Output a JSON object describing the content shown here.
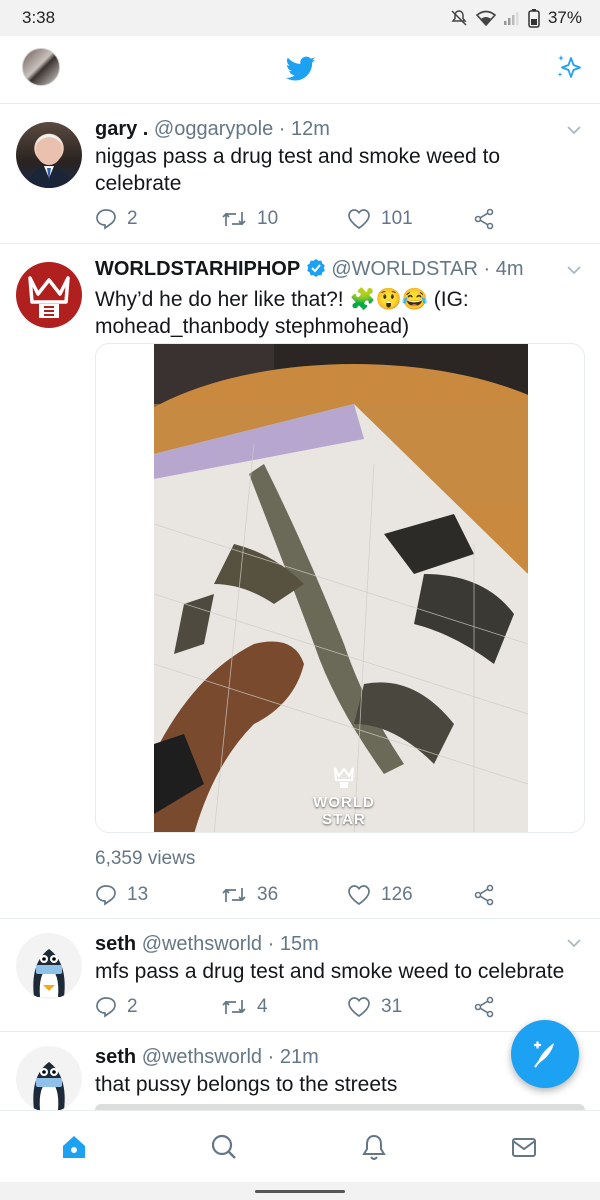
{
  "status_bar": {
    "time": "3:38",
    "battery": "37%"
  },
  "header": {
    "logo_icon": "twitter-bird-icon",
    "sparkle_icon": "sparkle-icon",
    "accent": "#1da1f2"
  },
  "tweets": [
    {
      "name": "gary .",
      "handle": "@oggarypole",
      "time": "12m",
      "text": "niggas pass a drug test and smoke weed to celebrate",
      "replies": "2",
      "retweets": "10",
      "likes": "101"
    },
    {
      "name": "WORLDSTARHIPHOP",
      "handle": "@WORLDSTAR",
      "time": "4m",
      "verified": true,
      "text_main": "Why’d he do her like that?! 🧩😲😂 (IG:",
      "text_cont": "mohead_thanbody stephmohead)",
      "video_watermark": "WORLD STAR",
      "views": "6,359 views",
      "replies": "13",
      "retweets": "36",
      "likes": "126"
    },
    {
      "name": "seth",
      "handle": "@wethsworld",
      "time": "15m",
      "text": "mfs pass a drug test and smoke weed to celebrate",
      "replies": "2",
      "retweets": "4",
      "likes": "31"
    },
    {
      "name": "seth",
      "handle": "@wethsworld",
      "time": "21m",
      "text": "that pussy belongs to the streets"
    }
  ],
  "nav": [
    "home-icon",
    "search-icon",
    "notifications-icon",
    "messages-icon"
  ],
  "colors": {
    "accent": "#1da1f2",
    "muted": "#657786",
    "verified": "#1da1f2"
  }
}
